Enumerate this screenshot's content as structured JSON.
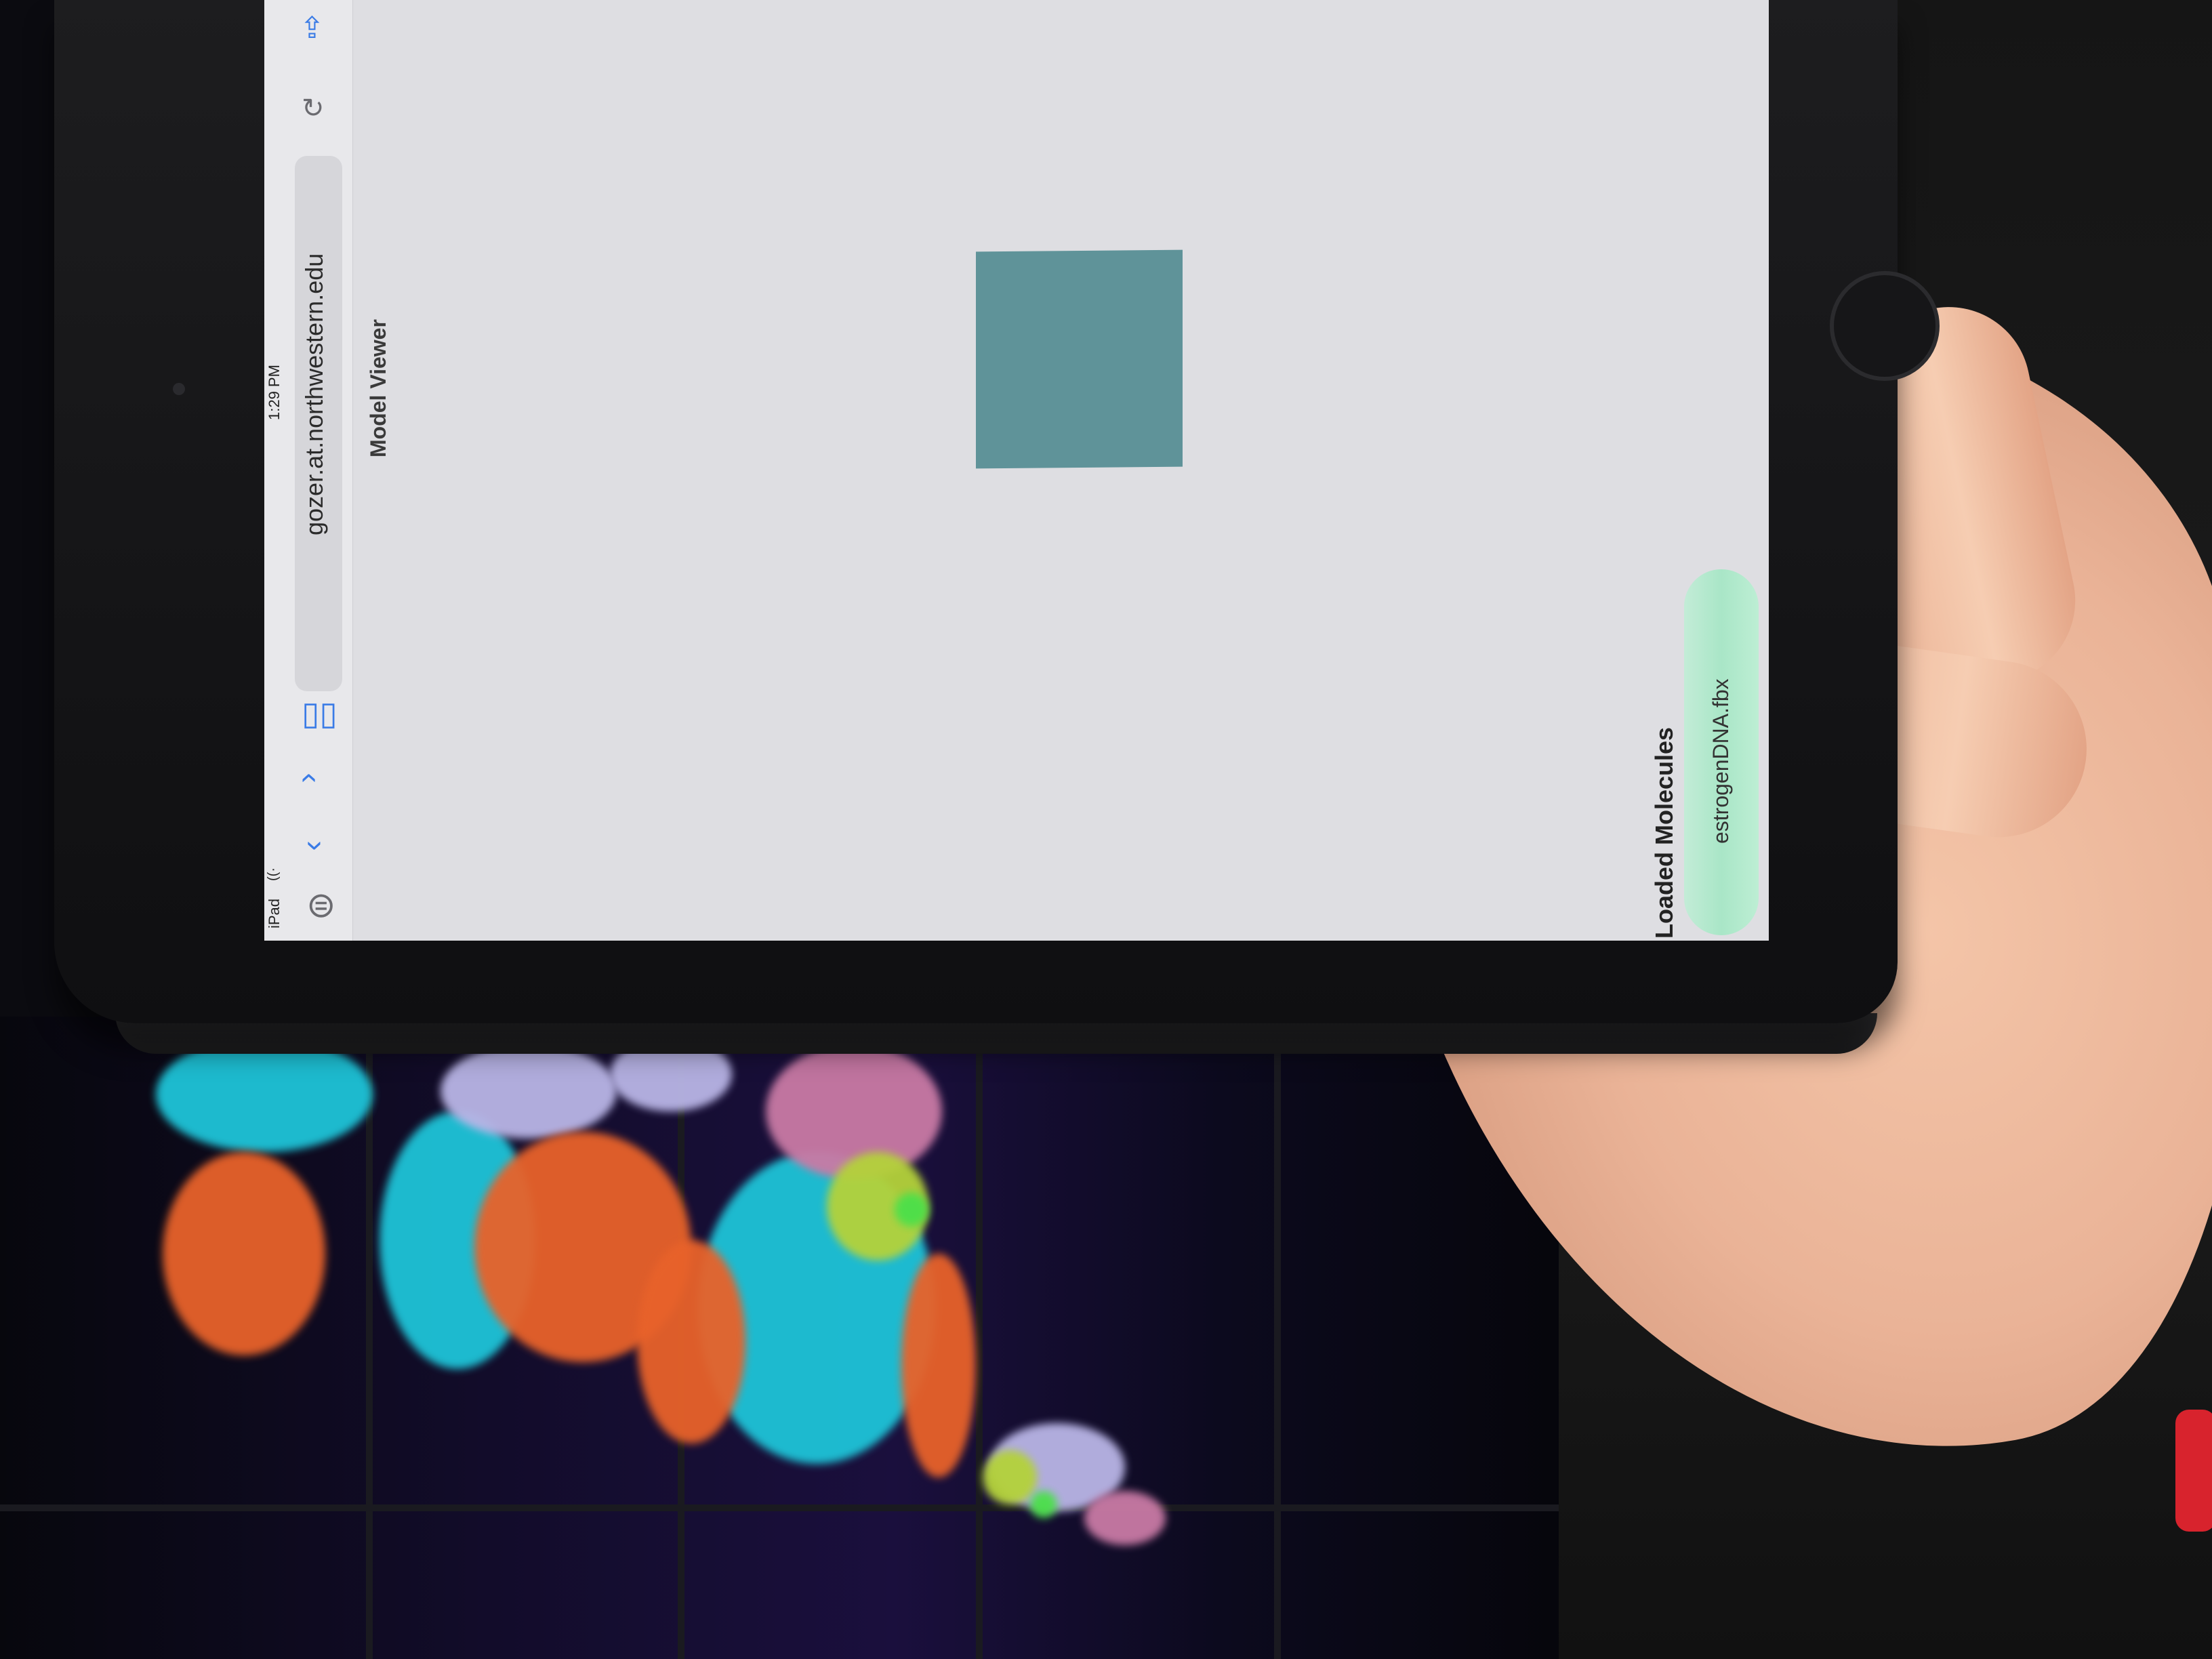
{
  "status_bar": {
    "device": "iPad",
    "time": "1:29 PM"
  },
  "browser": {
    "url": "gozer.at.northwestern.edu",
    "icons": [
      "back-chevron-icon",
      "forward-chevron-icon",
      "bookmarks-icon",
      "reload-icon",
      "share-icon",
      "menu-icon"
    ]
  },
  "page": {
    "title": "Model Viewer",
    "viewer_color": "#5f9399"
  },
  "loaded_molecules": {
    "heading": "Loaded Molecules",
    "items": [
      {
        "label": "estrogenDNA.fbx",
        "color": "#a9e6c7"
      }
    ]
  }
}
